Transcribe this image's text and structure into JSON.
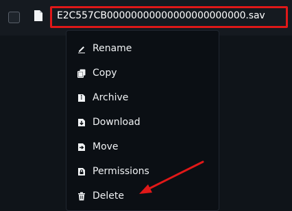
{
  "file": {
    "name": "E2C557CB00000000000000000000000.sav"
  },
  "menu": {
    "items": [
      {
        "label": "Rename",
        "icon": "pencil-icon"
      },
      {
        "label": "Copy",
        "icon": "copy-icon"
      },
      {
        "label": "Archive",
        "icon": "archive-icon"
      },
      {
        "label": "Download",
        "icon": "download-icon"
      },
      {
        "label": "Move",
        "icon": "move-icon"
      },
      {
        "label": "Permissions",
        "icon": "permissions-icon"
      },
      {
        "label": "Delete",
        "icon": "trash-icon"
      }
    ]
  },
  "colors": {
    "highlight": "#e01818",
    "menu_bg": "#0b0f14",
    "text": "#f1f3f5"
  }
}
